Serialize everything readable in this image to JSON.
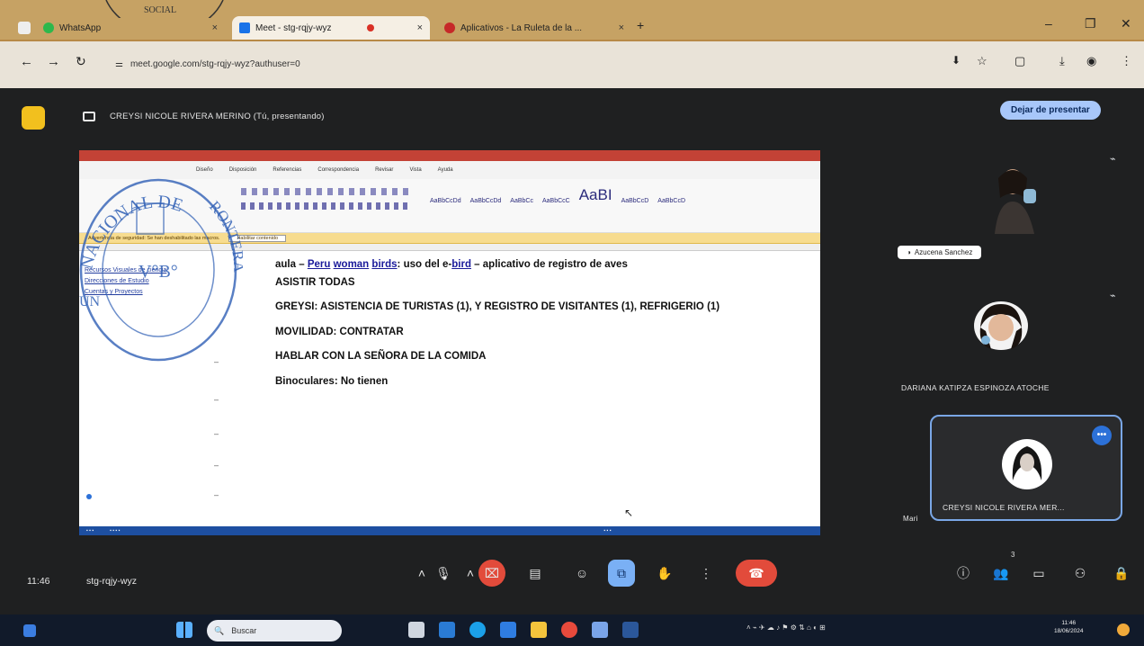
{
  "browser": {
    "tabs": [
      {
        "label": "WhatsApp",
        "close": "×"
      },
      {
        "label": "Meet - stg-rqjy-wyz",
        "close": "×"
      },
      {
        "label": "Aplicativos - La Ruleta de la ...",
        "close": "×"
      }
    ],
    "new_tab": "+",
    "window_controls": {
      "minimize": "–",
      "maximize": "❐",
      "close": "✕"
    },
    "url": "meet.google.com/stg-rqjy-wyz?authuser=0",
    "icons": [
      "back-icon",
      "forward-icon",
      "reload-icon",
      "site-info-icon",
      "download-icon",
      "star-icon",
      "extensions-icon",
      "downloads-icon",
      "profile-icon",
      "menu-icon"
    ]
  },
  "meet": {
    "presenting_title": "CREYSI NICOLE RIVERA MERINO (Tú, presentando)",
    "stop_presenting": "Dejar de presentar",
    "participants": [
      {
        "name": "Azucena Sanchez",
        "muted": true
      },
      {
        "name": "DARIANA KATIPZA ESPINOZA ATOCHE",
        "muted": true
      },
      {
        "name": "CREYSI NICOLE RIVERA MER...",
        "muted": false
      }
    ],
    "extra_label": "Mari",
    "meeting_time": "11:46",
    "meeting_code": "stg-rqjy-wyz",
    "more_badge": "•••",
    "people_count": "3"
  },
  "document": {
    "ribbon_tabs": [
      "Diseño",
      "Disposición",
      "Referencias",
      "Correspondencia",
      "Revisar",
      "Vista",
      "Ayuda"
    ],
    "styles": [
      "AaBbCcDd",
      "AaBbCcDd",
      "AaBbCc",
      "AaBbCcC",
      "AaBI",
      "AaBbCcD",
      "AaBbCcD"
    ],
    "warning_text": "Advertencia de seguridad: Se han deshabilitado las macros.",
    "warning_button": "Habilitar contenido",
    "nav_links": [
      "Recursos Visuales de ciencia",
      "Direcciones de Estudio",
      "Cuentas y Proyectos"
    ],
    "lines": [
      {
        "pre": "aula – ",
        "u1": "Peru",
        "mid1": " ",
        "u2": "woman",
        "mid2": " ",
        "u3": "birds",
        "post": ": uso del e-",
        "u4": "bird",
        "tail": " – aplicativo de registro de aves"
      },
      {
        "text": "ASISTIR TODAS"
      },
      {
        "text": "GREYSI: ASISTENCIA DE TURISTAS (1), Y REGISTRO DE VISITANTES (1), REFRIGERIO (1)"
      },
      {
        "text": "MOVILIDAD: CONTRATAR"
      },
      {
        "text": "HABLAR CON LA SEÑORA DE LA COMIDA"
      },
      {
        "text": "Binoculares: No tienen"
      }
    ]
  },
  "stamp": {
    "text_top": "NACIONAL DE",
    "text_right": "RONTERA",
    "text_left": "UN",
    "center": "V°B°",
    "header": "SOCIAL"
  },
  "taskbar": {
    "search_placeholder": "Buscar",
    "clock_time": "11:46",
    "clock_date": "18/06/2024"
  },
  "colors": {
    "tabbar": "#c6a264",
    "meet_bg": "#1f2021",
    "stop_button": "#a8c7fa",
    "hangup": "#e24b3b",
    "stamp": "#2f5fb5"
  }
}
